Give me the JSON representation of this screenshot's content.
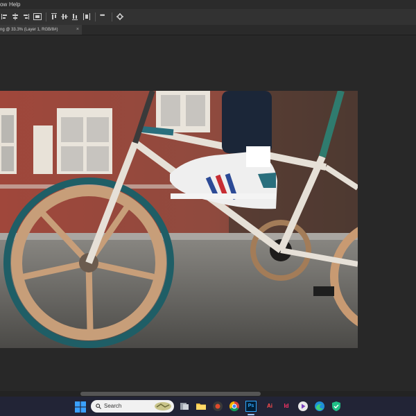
{
  "menu": {
    "items": [
      "ow",
      "Help"
    ]
  },
  "document_tab": {
    "label": "ng @ 33.3% (Layer 1, RGB/8#)",
    "close": "×"
  },
  "toolbar": {
    "more": "•••"
  },
  "taskbar": {
    "search_placeholder": "Search",
    "apps": [
      "start-icon",
      "file-explorer-icon",
      "chrome-icon",
      "photoshop-icon",
      "illustrator-icon",
      "indesign-icon",
      "edge-icon"
    ],
    "labels": {
      "photoshop": "Ps",
      "illustrator": "Ai",
      "indesign": "Id"
    }
  },
  "colors": {
    "app_bg": "#262626",
    "panel": "#323232",
    "taskbar": "#222436",
    "accent_blue": "#1f6fb5"
  }
}
